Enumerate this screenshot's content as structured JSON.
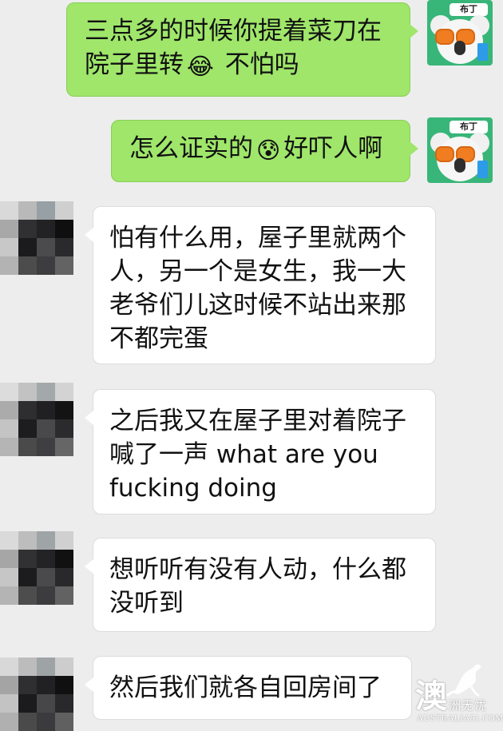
{
  "messages": [
    {
      "direction": "outgoing",
      "avatar_label": "布丁",
      "parts": [
        {
          "text": "三点多的时候你提着菜刀在院子里转"
        },
        {
          "emoji": "😂"
        },
        {
          "text": " 不怕吗"
        }
      ]
    },
    {
      "direction": "outgoing",
      "avatar_label": "布丁",
      "parts": [
        {
          "text": "怎么证实的"
        },
        {
          "emoji": "😰"
        },
        {
          "text": "好吓人啊"
        }
      ]
    },
    {
      "direction": "incoming",
      "text": "怕有什么用，屋子里就两个人，另一个是女生，我一大老爷们儿这时候不站出来那不都完蛋"
    },
    {
      "direction": "incoming",
      "text": "之后我又在屋子里对着院子喊了一声 what are you fucking doing"
    },
    {
      "direction": "incoming",
      "text": "想听听有没有人动，什么都没听到"
    },
    {
      "direction": "incoming",
      "text": "然后我们就各自回房间了"
    }
  ],
  "watermark": {
    "big_char": "澳",
    "small_text": "洲无忧",
    "domain": "AUSTRALIA51.COM"
  },
  "colors": {
    "background": "#ededed",
    "outgoing_bubble": "#9fe66a",
    "incoming_bubble": "#ffffff",
    "koala_avatar_bg": "#38b679"
  }
}
